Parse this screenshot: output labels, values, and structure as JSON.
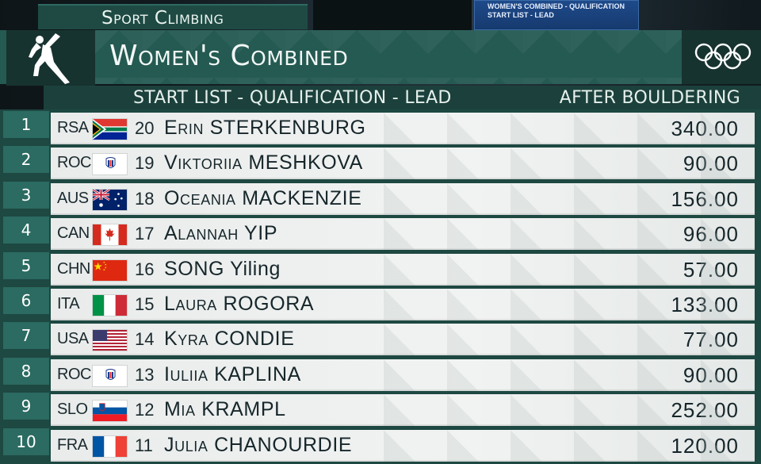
{
  "header": {
    "sport": "Sport Climbing",
    "title": "Women's Combined",
    "subtitle": "START LIST - QUALIFICATION - LEAD",
    "column_label": "AFTER BOULDERING"
  },
  "background_screen": {
    "line1": "WOMEN'S COMBINED - QUALIFICATION",
    "line2": "START LIST - LEAD"
  },
  "icons": {
    "pictogram": "sport-climbing-pictogram",
    "rings": "olympic-rings-icon"
  },
  "colors": {
    "accent": "#245a52",
    "rank_box": "#2b6b61",
    "row_bg": "#eef1f0"
  },
  "rows": [
    {
      "rank": "1",
      "noc": "RSA",
      "flag": "rsa",
      "bib": "20",
      "first": "Erin",
      "last": "STERKENBURG",
      "score": "340.00"
    },
    {
      "rank": "2",
      "noc": "ROC",
      "flag": "roc",
      "bib": "19",
      "first": "Viktoriia",
      "last": "MESHKOVA",
      "score": "90.00"
    },
    {
      "rank": "3",
      "noc": "AUS",
      "flag": "aus",
      "bib": "18",
      "first": "Oceania",
      "last": "MACKENZIE",
      "score": "156.00"
    },
    {
      "rank": "4",
      "noc": "CAN",
      "flag": "can",
      "bib": "17",
      "first": "Alannah",
      "last": "YIP",
      "score": "96.00"
    },
    {
      "rank": "5",
      "noc": "CHN",
      "flag": "chn",
      "bib": "16",
      "first": "SONG",
      "last": "Yiling",
      "score": "57.00"
    },
    {
      "rank": "6",
      "noc": "ITA",
      "flag": "ita",
      "bib": "15",
      "first": "Laura",
      "last": "ROGORA",
      "score": "133.00"
    },
    {
      "rank": "7",
      "noc": "USA",
      "flag": "usa",
      "bib": "14",
      "first": "Kyra",
      "last": "CONDIE",
      "score": "77.00"
    },
    {
      "rank": "8",
      "noc": "ROC",
      "flag": "roc",
      "bib": "13",
      "first": "Iuliia",
      "last": "KAPLINA",
      "score": "90.00"
    },
    {
      "rank": "9",
      "noc": "SLO",
      "flag": "slo",
      "bib": "12",
      "first": "Mia",
      "last": "KRAMPL",
      "score": "252.00"
    },
    {
      "rank": "10",
      "noc": "FRA",
      "flag": "fra",
      "bib": "11",
      "first": "Julia",
      "last": "CHANOURDIE",
      "score": "120.00"
    }
  ]
}
